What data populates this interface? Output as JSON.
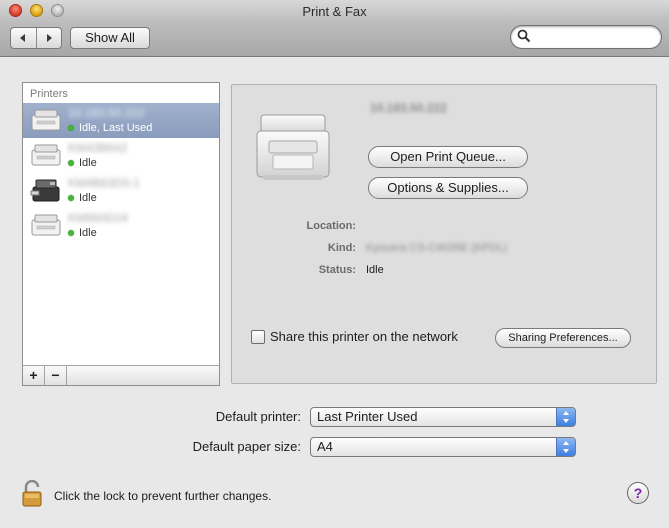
{
  "window": {
    "title": "Print & Fax"
  },
  "toolbar": {
    "back_icon": "back-arrow-icon",
    "forward_icon": "forward-arrow-icon",
    "show_all_label": "Show All",
    "search_value": ""
  },
  "printers": {
    "header": "Printers",
    "items": [
      {
        "name": "10.183.50.222",
        "status": "Idle, Last Used",
        "selected": true
      },
      {
        "name": "KM43B642",
        "status": "Idle",
        "selected": false
      },
      {
        "name": "KM4B83D0-1",
        "status": "Idle",
        "selected": false
      },
      {
        "name": "KM660D24",
        "status": "Idle",
        "selected": false
      }
    ],
    "add_label": "+",
    "remove_label": "−"
  },
  "detail": {
    "printer_name": "10.183.50.222",
    "open_queue_label": "Open Print Queue...",
    "options_label": "Options & Supplies...",
    "location_label": "Location:",
    "location_value": "",
    "kind_label": "Kind:",
    "kind_value": "Kyocera CS-C4035E (KPDL)",
    "status_label": "Status:",
    "status_value": "Idle",
    "share_label": "Share this printer on the network",
    "sharing_prefs_label": "Sharing Preferences..."
  },
  "defaults": {
    "printer_label": "Default printer:",
    "printer_value": "Last Printer Used",
    "paper_label": "Default paper size:",
    "paper_value": "A4"
  },
  "footer": {
    "lock_text": "Click the lock to prevent further changes.",
    "help_label": "?"
  },
  "colors": {
    "selection": "#8a9cbd",
    "status_dot": "#46b33a",
    "popup_arrow": "#3d7fe2"
  }
}
